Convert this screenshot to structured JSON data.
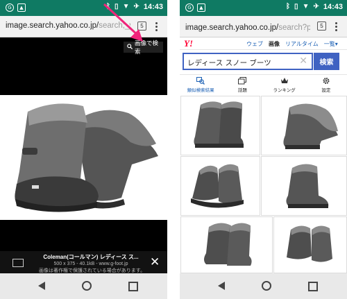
{
  "status": {
    "time": "14:43"
  },
  "browser": {
    "left": {
      "url_main": "image.search.yahoo.co.jp/",
      "url_rest": "search;_yl",
      "tab_count": "5"
    },
    "right": {
      "url_main": "image.search.yahoo.co.jp/",
      "url_rest": "search?p=レデ",
      "tab_count": "5"
    }
  },
  "viewer": {
    "image_search_button": "画像で検索",
    "info_title": "Coleman(コールマン) レディース ス...",
    "info_size": "500 x 375 - 40.1kB - www.g-foot.jp",
    "info_note": "画像は著作権で保護されている場合があります。"
  },
  "yahoo": {
    "logo": "Y!",
    "tabs": [
      "ウェブ",
      "画像",
      "リアルタイム",
      "一覧▾"
    ],
    "search_query": "レディース スノー ブーツ",
    "search_button": "検索",
    "toolbar": [
      "類似検索結果",
      "話題",
      "ランキング",
      "設定"
    ]
  },
  "colors": {
    "status": "#0f7a63",
    "yahoo_blue": "#3f62c2",
    "yahoo_red": "#ff0033",
    "arrow": "#f0247a"
  }
}
